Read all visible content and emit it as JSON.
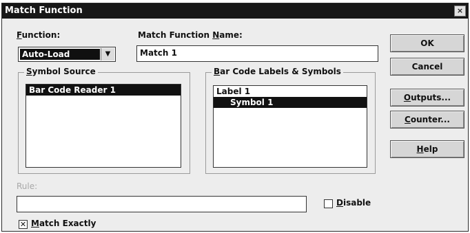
{
  "window": {
    "title": "Match Function",
    "close_glyph": "×"
  },
  "function": {
    "label_underlined": "F",
    "label_rest": "unction:",
    "value": "Auto-Load",
    "arrow_glyph": "▼"
  },
  "match_name": {
    "label_prefix": "Match Function ",
    "label_underlined": "N",
    "label_rest": "ame:",
    "value": "Match 1"
  },
  "symbol_source": {
    "title_underlined": "S",
    "title_rest": "ymbol Source",
    "items": [
      "Bar Code Reader 1"
    ]
  },
  "barcode_labels": {
    "title_underlined": "B",
    "title_rest": "ar Code Labels & Symbols",
    "items": [
      "Label 1",
      "Symbol 1"
    ]
  },
  "rule": {
    "label": "Rule:",
    "value": ""
  },
  "disable": {
    "label_underlined": "D",
    "label_rest": "isable",
    "checked_glyph": ""
  },
  "match_exactly": {
    "label_underlined": "M",
    "label_rest": "atch Exactly",
    "checked_glyph": "✕"
  },
  "buttons": {
    "ok": "OK",
    "cancel": "Cancel",
    "outputs_underlined": "O",
    "outputs_rest": "utputs...",
    "counter_underlined": "C",
    "counter_rest": "ounter...",
    "help_underlined": "H",
    "help_rest": "elp"
  }
}
